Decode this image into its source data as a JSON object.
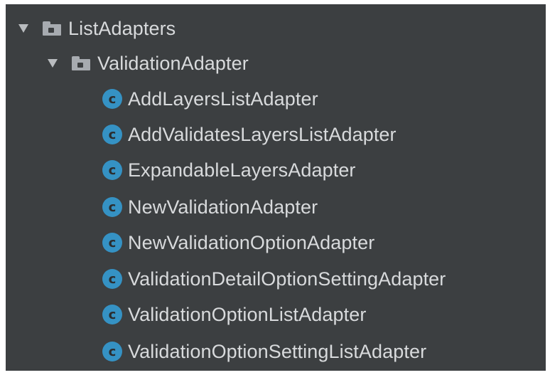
{
  "tree": {
    "root_folder": {
      "label": "ListAdapters",
      "expanded": true,
      "icon": "folder-icon"
    },
    "sub_folder": {
      "label": "ValidationAdapter",
      "expanded": true,
      "icon": "folder-icon"
    },
    "class_icon_glyph": "c",
    "class_icon_color": "#3592c4",
    "background_color": "#3c3f41",
    "items": [
      {
        "label": "AddLayersListAdapter"
      },
      {
        "label": "AddValidatesLayersListAdapter"
      },
      {
        "label": "ExpandableLayersAdapter"
      },
      {
        "label": "NewValidationAdapter"
      },
      {
        "label": "NewValidationOptionAdapter"
      },
      {
        "label": "ValidationDetailOptionSettingAdapter"
      },
      {
        "label": "ValidationOptionListAdapter"
      },
      {
        "label": "ValidationOptionSettingListAdapter"
      }
    ]
  }
}
